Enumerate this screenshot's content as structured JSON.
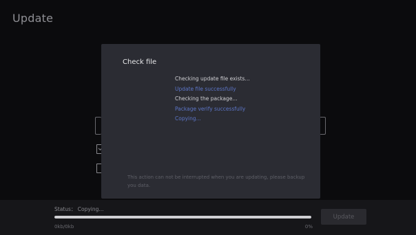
{
  "page": {
    "title": "Update"
  },
  "dialog": {
    "title": "Check file",
    "log": [
      {
        "text": "Checking update file exists...",
        "kind": "info"
      },
      {
        "text": "Update file successfully",
        "kind": "success"
      },
      {
        "text": "Checking the package...",
        "kind": "info"
      },
      {
        "text": "Package verify successfully",
        "kind": "success"
      },
      {
        "text": "Copying...",
        "kind": "success"
      }
    ],
    "warning": "This action can not be interrupted when you are updating, please backup you data."
  },
  "status": {
    "label": "Status： Copying...",
    "progress_fraction": 1.0,
    "size": "0kb/0kb",
    "percent": "0%"
  },
  "actions": {
    "update_label": "Update"
  },
  "colors": {
    "dialog_bg": "#2b2c33",
    "success_text": "#5c75c7",
    "info_text": "#cfcfd3"
  },
  "icons": {
    "checkbox_checked": "checkbox-checked-icon",
    "checkbox_unchecked": "checkbox-unchecked-icon"
  }
}
